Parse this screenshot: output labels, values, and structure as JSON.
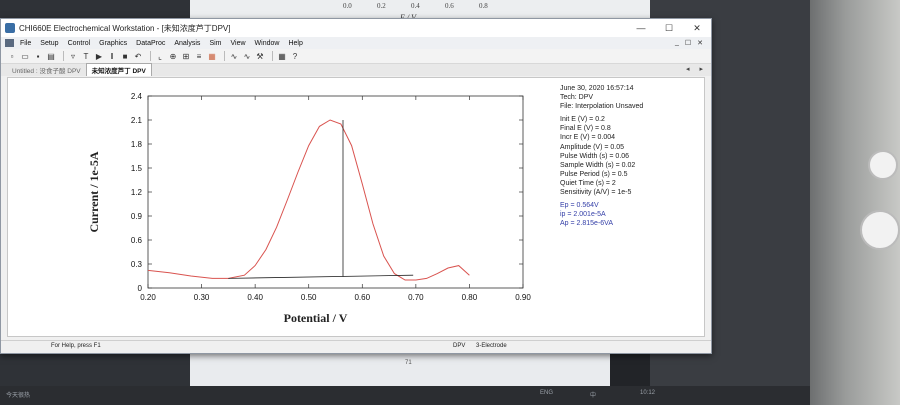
{
  "background": {
    "paper_ticks": [
      "0.0",
      "0.2",
      "0.4",
      "0.6",
      "0.8"
    ],
    "paper_axis_label": "E / V",
    "bottom_paper_number": "71"
  },
  "window": {
    "title": "CHI660E Electrochemical Workstation - [未知浓度芦丁DPV]",
    "controls": [
      "—",
      "☐",
      "✕"
    ],
    "menu": [
      "File",
      "Setup",
      "Control",
      "Graphics",
      "DataProc",
      "Analysis",
      "Sim",
      "View",
      "Window",
      "Help"
    ],
    "menu_right": [
      "_",
      "☐",
      "✕"
    ],
    "tabs": [
      {
        "label": "Untitled : 没食子酸 DPV",
        "active": false
      },
      {
        "label": "未知浓度芦丁 DPV",
        "active": true
      }
    ],
    "tab_nav": [
      "◂",
      "▸"
    ]
  },
  "toolbar": {
    "groups": [
      [
        "new-icon",
        "open-icon",
        "save-icon",
        "print-icon"
      ],
      [
        "technique-icon",
        "parameters-icon",
        "run-icon",
        "pause-icon",
        "stop-icon",
        "reverse-icon"
      ],
      [
        "graph-icon",
        "overlay-icon",
        "add-icon",
        "zoom-icon",
        "smooth-icon"
      ],
      [
        "tools-icon",
        "color-icon"
      ],
      [
        "help-icon"
      ]
    ]
  },
  "plot": {
    "info": {
      "date": "June 30, 2020    16:57:14",
      "tech": "Tech: DPV",
      "file": "File: Interpolation Unsaved",
      "params": [
        "Init E (V) = 0.2",
        "Final E (V) = 0.8",
        "Incr E (V) = 0.004",
        "Amplitude (V) = 0.05",
        "Pulse Width (s) = 0.06",
        "Sample Width (s) = 0.02",
        "Pulse Period (s) = 0.5",
        "Quiet Time (s) = 2",
        "Sensitivity (A/V) = 1e-5"
      ],
      "results": [
        "Ep = 0.564V",
        "ip = 2.001e-5A",
        "Ap = 2.815e-6VA"
      ]
    }
  },
  "chart_data": {
    "type": "line",
    "title": "",
    "xlabel": "Potential / V",
    "ylabel": "Current / 1e-5A",
    "xlim": [
      0.2,
      0.9
    ],
    "ylim": [
      0,
      2.4
    ],
    "xticks": [
      "0.20",
      "0.30",
      "0.40",
      "0.50",
      "0.60",
      "0.70",
      "0.80",
      "0.90"
    ],
    "yticks": [
      "0",
      "0.3",
      "0.6",
      "0.9",
      "1.2",
      "1.5",
      "1.8",
      "2.1",
      "2.4"
    ],
    "series": [
      {
        "color": "#d9534f",
        "x": [
          0.2,
          0.24,
          0.28,
          0.32,
          0.35,
          0.38,
          0.4,
          0.42,
          0.44,
          0.46,
          0.48,
          0.5,
          0.52,
          0.54,
          0.56,
          0.58,
          0.6,
          0.62,
          0.64,
          0.66,
          0.68,
          0.7,
          0.72,
          0.74,
          0.76,
          0.78,
          0.8
        ],
        "y": [
          0.22,
          0.19,
          0.15,
          0.12,
          0.12,
          0.16,
          0.28,
          0.48,
          0.76,
          1.1,
          1.45,
          1.78,
          2.02,
          2.1,
          2.05,
          1.78,
          1.3,
          0.8,
          0.4,
          0.18,
          0.1,
          0.1,
          0.12,
          0.18,
          0.25,
          0.28,
          0.16
        ]
      }
    ],
    "baseline": {
      "x": [
        0.35,
        0.695
      ],
      "y": [
        0.12,
        0.16
      ]
    },
    "peak_marker": {
      "x": 0.564,
      "y_from": 0.14,
      "y_to": 2.1
    }
  },
  "statusbar": {
    "left": "For Help, press F1",
    "mid": "DPV",
    "right": "3-Electrode"
  },
  "taskbar": {
    "left": "今天很热",
    "items": [
      "ENG",
      "中",
      "10:12"
    ]
  }
}
